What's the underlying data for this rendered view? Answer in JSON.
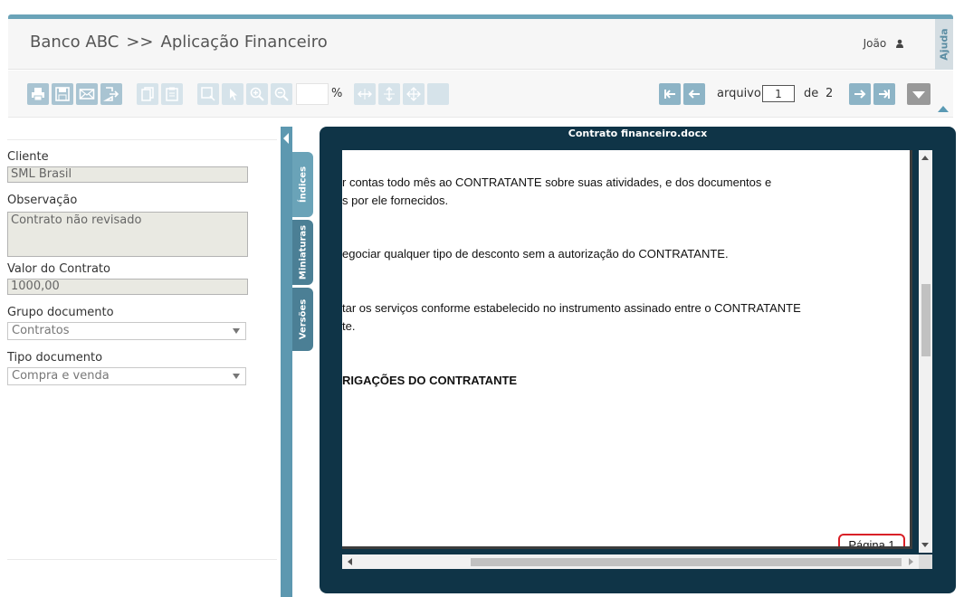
{
  "breadcrumb": {
    "root": "Banco ABC",
    "separator": ">>",
    "current": "Aplicação Financeiro"
  },
  "user": {
    "name": "João",
    "icon": "user-icon"
  },
  "help_tab": "Ajuda",
  "toolbar": {
    "groups": [
      [
        "print-icon",
        "save-icon",
        "email-icon",
        "export-icon"
      ],
      [
        "copy-document-icon",
        "paste-document-icon"
      ],
      [
        "select-area-icon",
        "pointer-icon",
        "zoom-in-icon",
        "zoom-out-icon"
      ],
      [
        "fit-width-icon",
        "fit-height-icon",
        "fit-page-icon",
        "blank-tool-icon"
      ]
    ],
    "zoom_value": "",
    "zoom_unit": "%",
    "file_label": "arquivo",
    "file_current": "1",
    "file_of_label": "de",
    "file_total": "2"
  },
  "form": {
    "cliente": {
      "label": "Cliente",
      "value": "SML Brasil"
    },
    "observacao": {
      "label": "Observação",
      "value": "Contrato não revisado"
    },
    "valor": {
      "label": "Valor do Contrato",
      "value": "1000,00"
    },
    "grupo": {
      "label": "Grupo documento",
      "selected": "Contratos"
    },
    "tipo": {
      "label": "Tipo documento",
      "selected": "Compra e venda"
    }
  },
  "side_tabs": [
    "Índices",
    "Miniaturas",
    "Versões"
  ],
  "viewer": {
    "title": "Contrato financeiro.docx",
    "lines": [
      "r contas todo mês ao CONTRATANTE sobre suas atividades, e dos documentos e",
      "s por ele fornecidos.",
      "egociar qualquer tipo de desconto sem a autorização do CONTRATANTE.",
      "tar os serviços conforme estabelecido no instrumento assinado entre o CONTRATANTE",
      "te.",
      "RIGAÇÕES DO CONTRATANTE"
    ],
    "page_label": "Página 1"
  },
  "colors": {
    "accent": "#6aa3b8",
    "viewer_bg": "#0f3447",
    "tab_dark": "#4b7f95",
    "page_badge_border": "#d92027"
  }
}
